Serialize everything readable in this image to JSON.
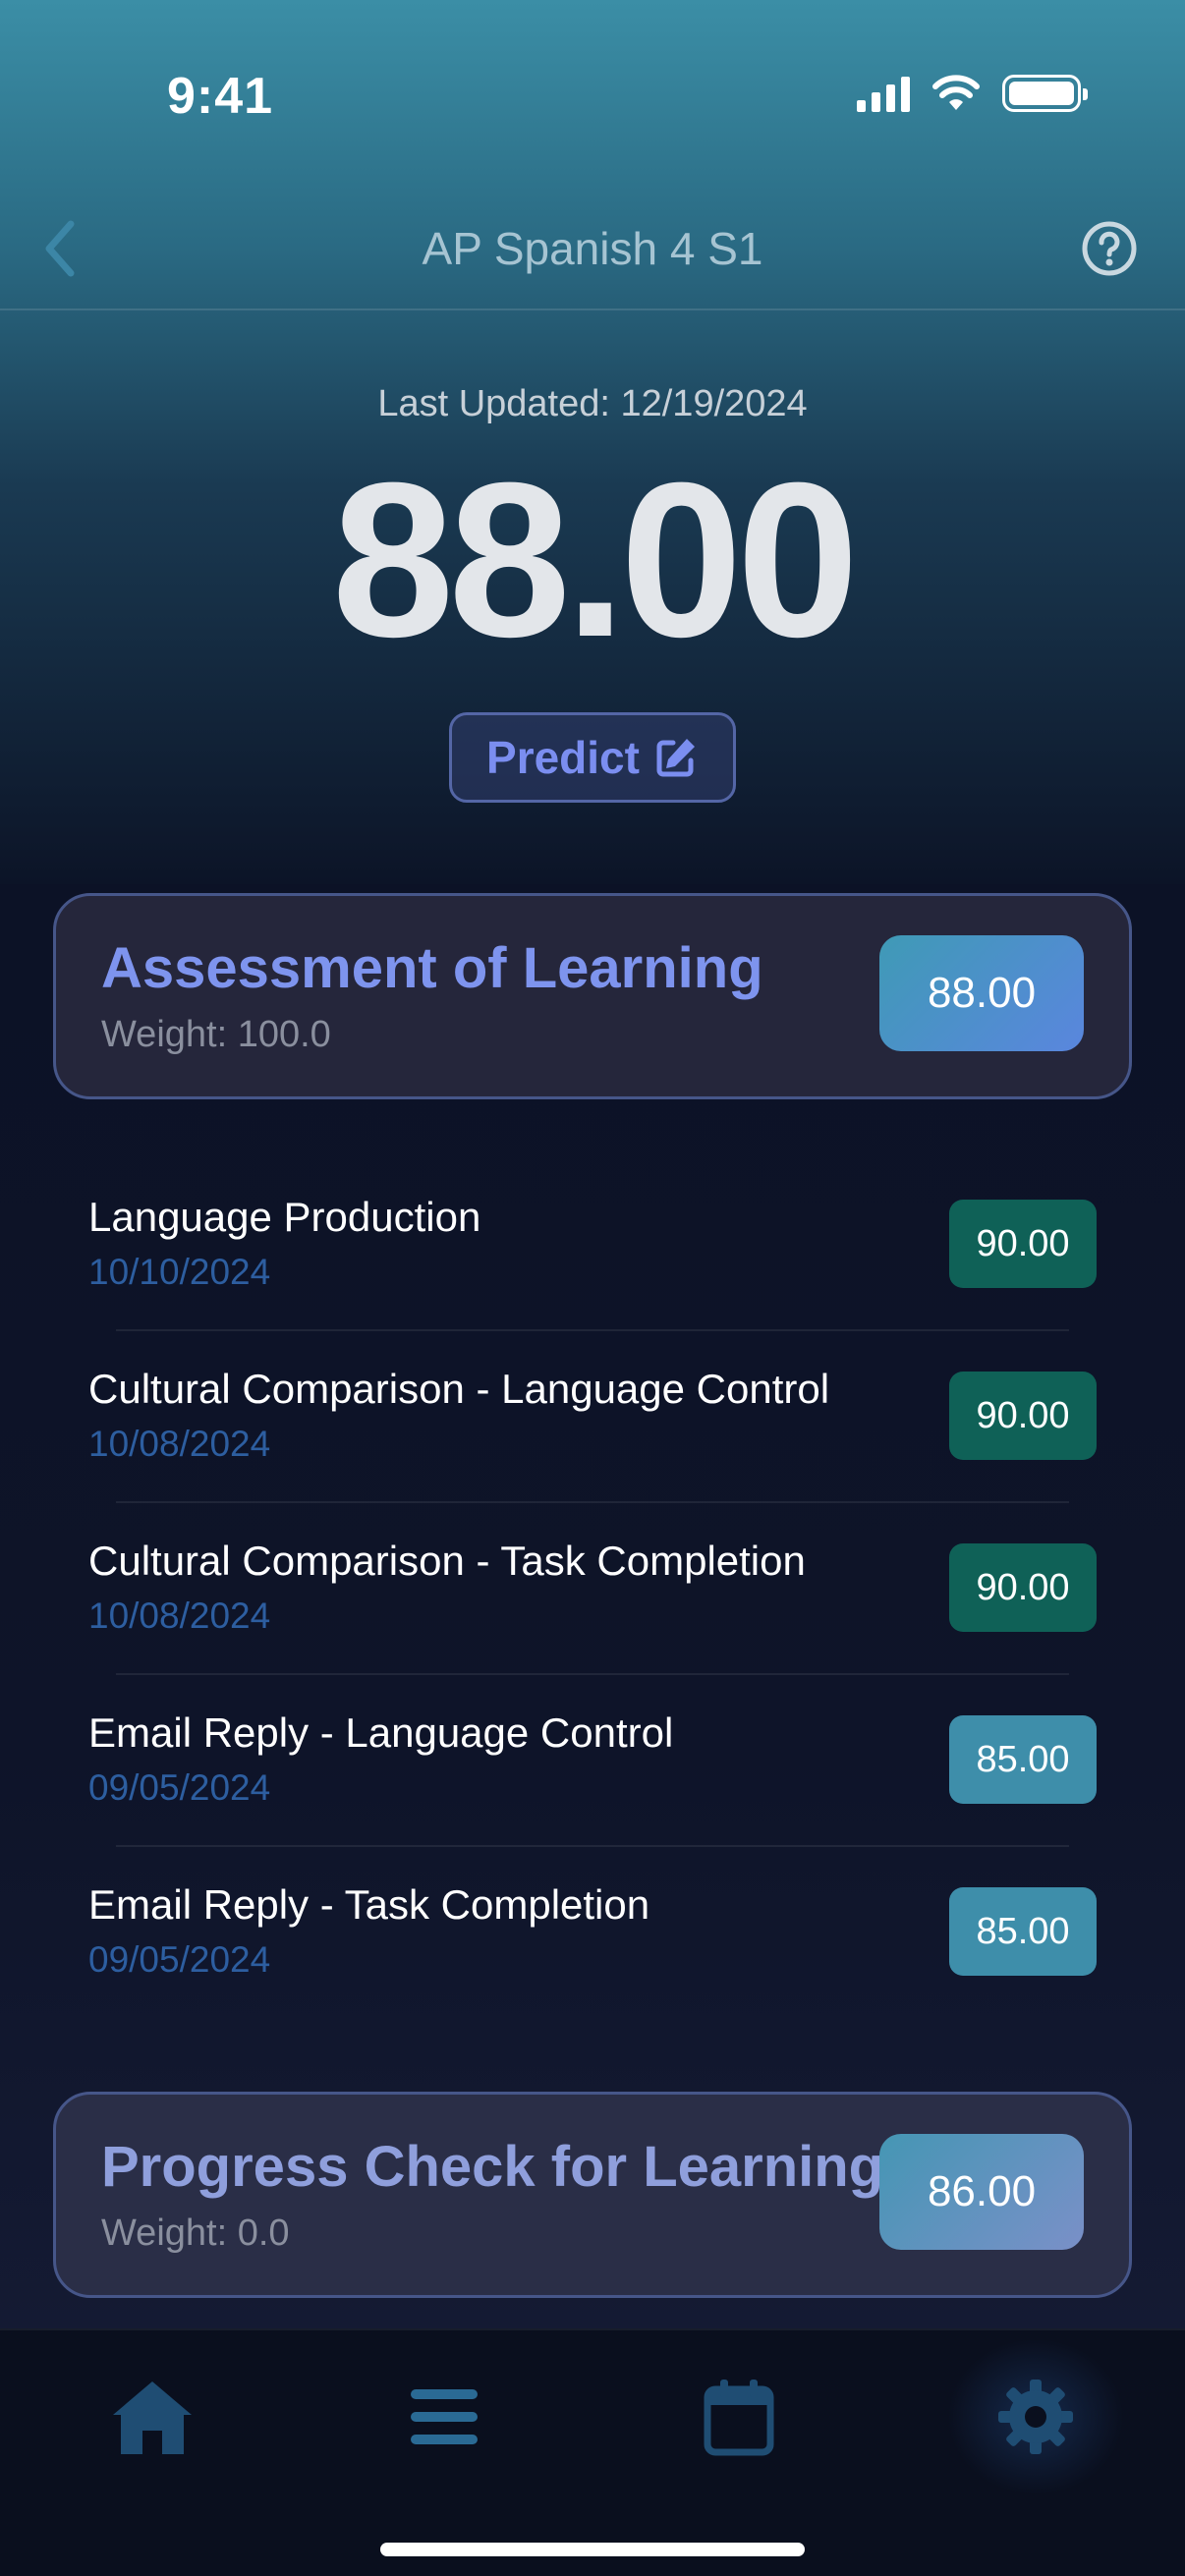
{
  "status_bar": {
    "time": "9:41"
  },
  "nav": {
    "title": "AP Spanish 4 S1"
  },
  "hero": {
    "last_updated": "Last Updated: 12/19/2024",
    "grade": "88.00",
    "predict_label": "Predict"
  },
  "categories": [
    {
      "title": "Assessment of Learning",
      "weight": "Weight: 100.0",
      "score": "88.00"
    },
    {
      "title": "Progress Check for Learning",
      "weight": "Weight: 0.0",
      "score": "86.00"
    }
  ],
  "assignments": [
    {
      "name": "Language Production",
      "date": "10/10/2024",
      "score": "90.00"
    },
    {
      "name": "Cultural Comparison - Language Control",
      "date": "10/08/2024",
      "score": "90.00"
    },
    {
      "name": "Cultural Comparison - Task Completion",
      "date": "10/08/2024",
      "score": "90.00"
    },
    {
      "name": "Email Reply - Language Control",
      "date": "09/05/2024",
      "score": "85.00"
    },
    {
      "name": "Email Reply - Task Completion",
      "date": "09/05/2024",
      "score": "85.00"
    }
  ],
  "tabs": [
    {
      "icon": "home-icon"
    },
    {
      "icon": "list-icon"
    },
    {
      "icon": "calendar-icon"
    },
    {
      "icon": "gear-icon"
    }
  ],
  "colors": {
    "accent": "#7b8ef0",
    "score_high": "#0f6157",
    "score_mid": "#3e8eaa",
    "date": "#2d5ea0"
  }
}
